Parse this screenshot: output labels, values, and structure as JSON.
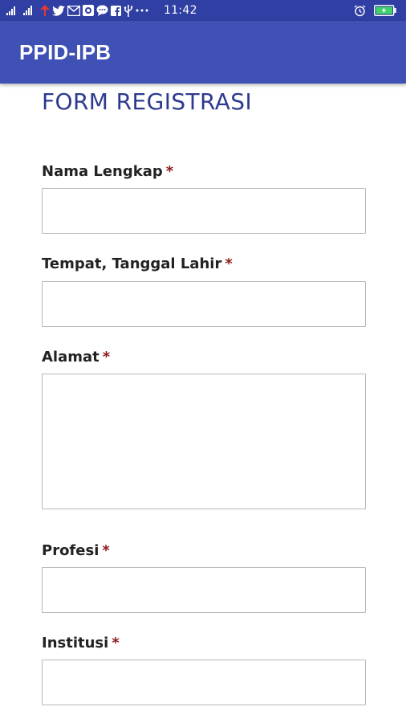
{
  "status_bar": {
    "time": "11:42",
    "icons": [
      "signal-icon",
      "signal-2-icon",
      "location-icon",
      "twitter-icon",
      "mail-icon",
      "messenger-app-icon",
      "chat-icon",
      "facebook-icon",
      "usb-icon",
      "more-icon",
      "alarm-icon",
      "battery-icon"
    ]
  },
  "app_bar": {
    "title": "PPID-IPB",
    "color": "#3f51b5"
  },
  "form": {
    "heading": "FORM REGISTRASI",
    "required_mark": "*",
    "fields": [
      {
        "label": "Nama Lengkap",
        "value": "",
        "type": "text"
      },
      {
        "label": "Tempat, Tanggal Lahir",
        "value": "",
        "type": "text"
      },
      {
        "label": "Alamat",
        "value": "",
        "type": "textarea"
      },
      {
        "label": "Profesi",
        "value": "",
        "type": "text"
      },
      {
        "label": "Institusi",
        "value": "",
        "type": "text"
      }
    ]
  },
  "colors": {
    "status_bar": "#2f3fa3",
    "heading": "#2d3a8f",
    "required": "#8b1a1a"
  }
}
